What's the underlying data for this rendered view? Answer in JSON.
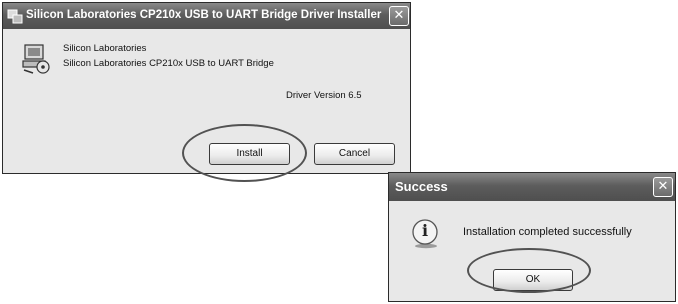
{
  "installer": {
    "title": "Silicon Laboratories CP210x USB to UART Bridge Driver Installer",
    "publisher": "Silicon Laboratories",
    "product": "Silicon Laboratories CP210x USB to UART Bridge",
    "version_text": "Driver Version 6.5",
    "install_label": "Install",
    "cancel_label": "Cancel",
    "close_glyph": "✕"
  },
  "success": {
    "title": "Success",
    "message": "Installation completed successfully",
    "ok_label": "OK",
    "close_glyph": "✕",
    "icon_glyph": "i"
  },
  "colors": {
    "dialog_bg": "#ece9d8",
    "highlight_ring": "#c8313a"
  }
}
